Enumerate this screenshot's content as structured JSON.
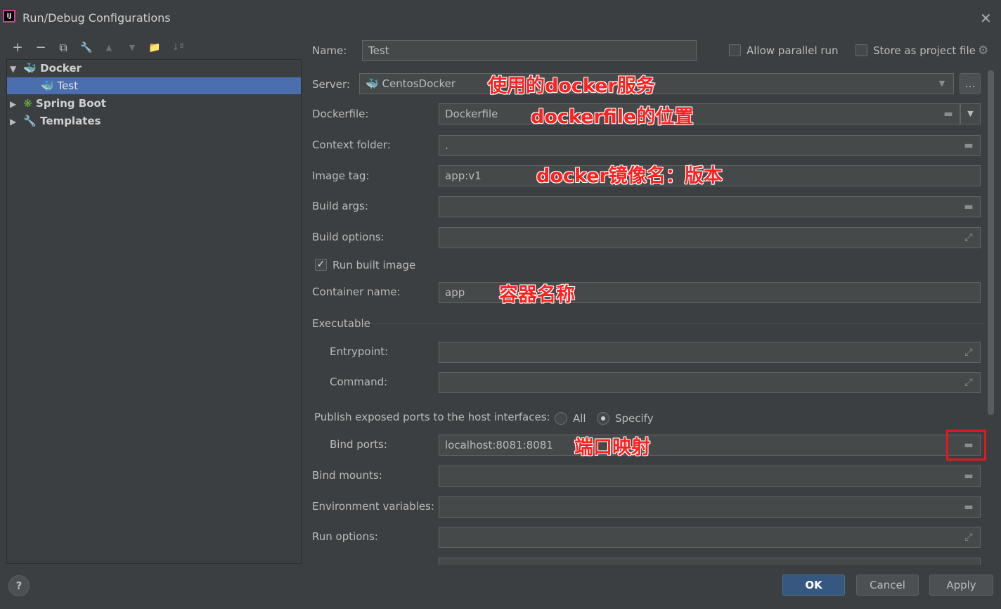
{
  "window": {
    "title": "Run/Debug Configurations",
    "app_icon_text": "IJ"
  },
  "toolbar": {
    "add": "+",
    "remove": "−",
    "copy": "⧉",
    "edit": "🔧",
    "up": "▲",
    "down": "▼",
    "folder": "📁",
    "sort": "↓ª"
  },
  "tree": {
    "docker": "Docker",
    "test": "Test",
    "spring_boot": "Spring Boot",
    "templates": "Templates"
  },
  "header": {
    "name_label": "Name:",
    "name_value": "Test",
    "allow_parallel": "Allow parallel run",
    "store_project": "Store as project file"
  },
  "form": {
    "server_label": "Server:",
    "server_value": "CentosDocker",
    "server_more": "...",
    "dockerfile_label": "Dockerfile:",
    "dockerfile_value": "Dockerfile",
    "context_label": "Context folder:",
    "context_value": ".",
    "image_tag_label": "Image tag:",
    "image_tag_value": "app:v1",
    "build_args_label": "Build args:",
    "build_args_value": "",
    "build_options_label": "Build options:",
    "build_options_value": "",
    "run_built_label": "Run built image",
    "container_label": "Container name:",
    "container_value": "app",
    "executable_label": "Executable",
    "entrypoint_label": "Entrypoint:",
    "entrypoint_value": "",
    "command_label": "Command:",
    "command_value": "",
    "publish_label": "Publish exposed ports to the host interfaces:",
    "radio_all": "All",
    "radio_specify": "Specify",
    "bind_ports_label": "Bind ports:",
    "bind_ports_value": "localhost:8081:8081",
    "bind_mounts_label": "Bind mounts:",
    "bind_mounts_value": "",
    "env_label": "Environment variables:",
    "env_value": "",
    "run_options_label": "Run options:",
    "run_options_value": ""
  },
  "annotations": {
    "server": "使用的docker服务",
    "dockerfile": "dockerfile的位置",
    "image_tag": "docker镜像名：版本",
    "container": "容器名称",
    "ports": "端口映射"
  },
  "footer": {
    "help": "?",
    "ok": "OK",
    "cancel": "Cancel",
    "apply": "Apply"
  },
  "colors": {
    "background": "#3c3f41",
    "selection": "#4b6eaf",
    "field": "#45494a",
    "annotation": "#ff2020",
    "highlight_box": "#e0191d"
  }
}
